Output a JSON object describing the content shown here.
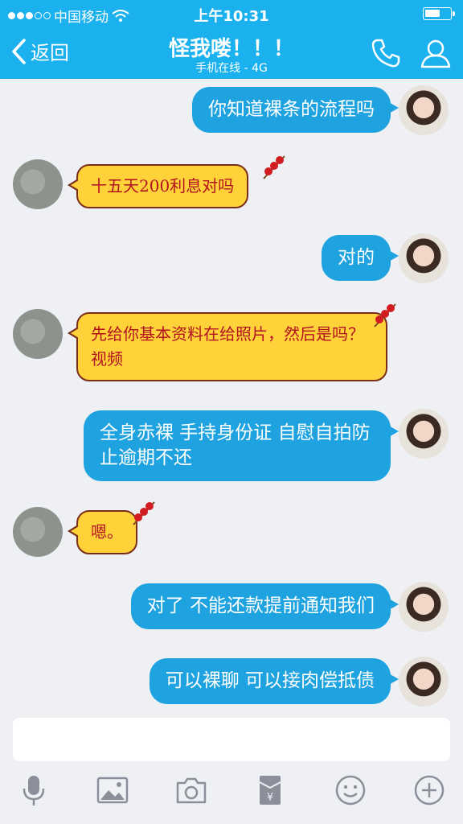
{
  "status_bar": {
    "carrier": "中国移动",
    "time": "上午10:31",
    "battery_percent": 60
  },
  "header": {
    "back_label": "返回",
    "title": "怪我喽！！！",
    "subtitle": "手机在线 - 4G"
  },
  "messages": [
    {
      "side": "out",
      "text": "你知道裸条的流程吗"
    },
    {
      "side": "in",
      "text": "十五天200利息对吗"
    },
    {
      "side": "out",
      "text": "对的"
    },
    {
      "side": "in",
      "text": "先给你基本资料在给照片，然后是吗？视频"
    },
    {
      "side": "out",
      "text": "全身赤裸 手持身份证 自慰自拍防止逾期不还"
    },
    {
      "side": "in",
      "text": "嗯。"
    },
    {
      "side": "out",
      "text": "对了 不能还款提前通知我们"
    },
    {
      "side": "out",
      "text": "可以裸聊 可以接肉偿抵债"
    }
  ],
  "toolbar_icons": [
    "microphone-icon",
    "image-icon",
    "camera-icon",
    "red-packet-icon",
    "emoji-icon",
    "plus-icon"
  ],
  "colors": {
    "accent": "#1ab1ee",
    "out_bubble": "#1ea3e0",
    "in_bubble": "#ffd23a",
    "in_text": "#b3131f"
  }
}
